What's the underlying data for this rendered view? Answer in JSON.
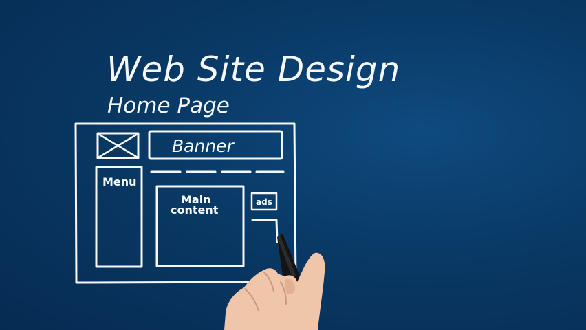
{
  "title": "Web Site Design",
  "subtitle": "Home Page",
  "wireframe": {
    "banner_label": "Banner",
    "menu_label": "Menu",
    "main_label_line1": "Main",
    "main_label_line2": "content",
    "ads_label": "ads",
    "logo_placeholder": "image-placeholder-icon"
  },
  "colors": {
    "background": "#083866",
    "chalk": "#f4f7fb",
    "skin": "#f0c6aa",
    "marker": "#141414"
  }
}
